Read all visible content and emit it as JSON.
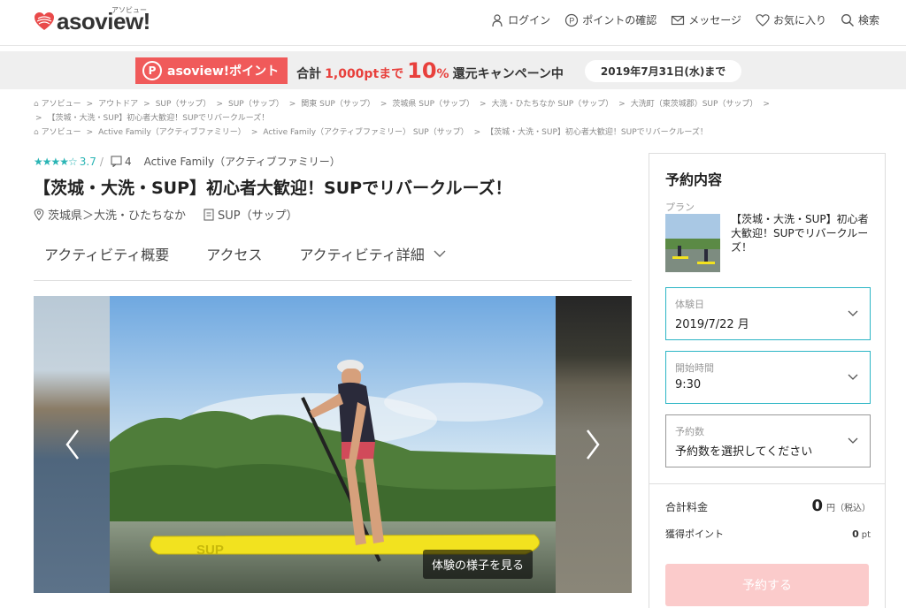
{
  "header": {
    "logo_text": "asoview!",
    "logo_kana": "アソビュー",
    "nav": [
      "ログイン",
      "ポイントの確認",
      "メッセージ",
      "お気に入り",
      "検索"
    ]
  },
  "banner": {
    "points_label": "asoview!ポイント",
    "points_icon": "P",
    "total": "合計",
    "amount": "1,000ptまで",
    "percent": "10",
    "percent_unit": "%",
    "rest": "還元キャンペーン中",
    "date": "2019年7月31日(水)まで"
  },
  "breadcrumb1": [
    "アソビュー",
    "アウトドア",
    "SUP（サップ）",
    "SUP（サップ）",
    "関東 SUP（サップ）",
    "茨城県 SUP（サップ）",
    "大洗・ひたちなか SUP（サップ）",
    "大洗町（東茨城郡）SUP（サップ）"
  ],
  "breadcrumb1b": "【茨城・大洗・SUP】初心者大歓迎！SUPでリバークルーズ！",
  "breadcrumb2": [
    "アソビュー",
    "Active Family（アクティブファミリー）",
    "Active Family（アクティブファミリー） SUP（サップ）",
    "【茨城・大洗・SUP】初心者大歓迎！SUPでリバークルーズ！"
  ],
  "activity": {
    "stars": "★★★★☆",
    "score": "3.7",
    "review_count": "4",
    "provider": "Active Family（アクティブファミリー）",
    "title": "【茨城・大洗・SUP】初心者大歓迎！SUPでリバークルーズ！",
    "area": "茨城県＞大洗・ひたちなか",
    "category": "SUP（サップ）"
  },
  "tabs": [
    "アクティビティ概要",
    "アクセス",
    "アクティビティ詳細"
  ],
  "carousel": {
    "see_button": "体験の様子を見る",
    "board_text": "SUP"
  },
  "booking": {
    "heading": "予約内容",
    "plan_label": "プラン",
    "plan_name": "【茨城・大洗・SUP】初心者大歓迎！SUPでリバークルーズ！",
    "date_label": "体験日",
    "date_value": "2019/7/22 月",
    "time_label": "開始時間",
    "time_value": "9:30",
    "count_label": "予約数",
    "count_placeholder": "予約数を選択してください",
    "total_label": "合計料金",
    "total_value": "0",
    "total_unit": "円（税込）",
    "points_label": "獲得ポイント",
    "points_value": "0",
    "points_unit": "pt",
    "reserve_button": "予約する"
  },
  "colors": {
    "accent": "#2bb5b5",
    "brand_red": "#f05a5a",
    "reserve_pink": "#fbcbcb"
  }
}
